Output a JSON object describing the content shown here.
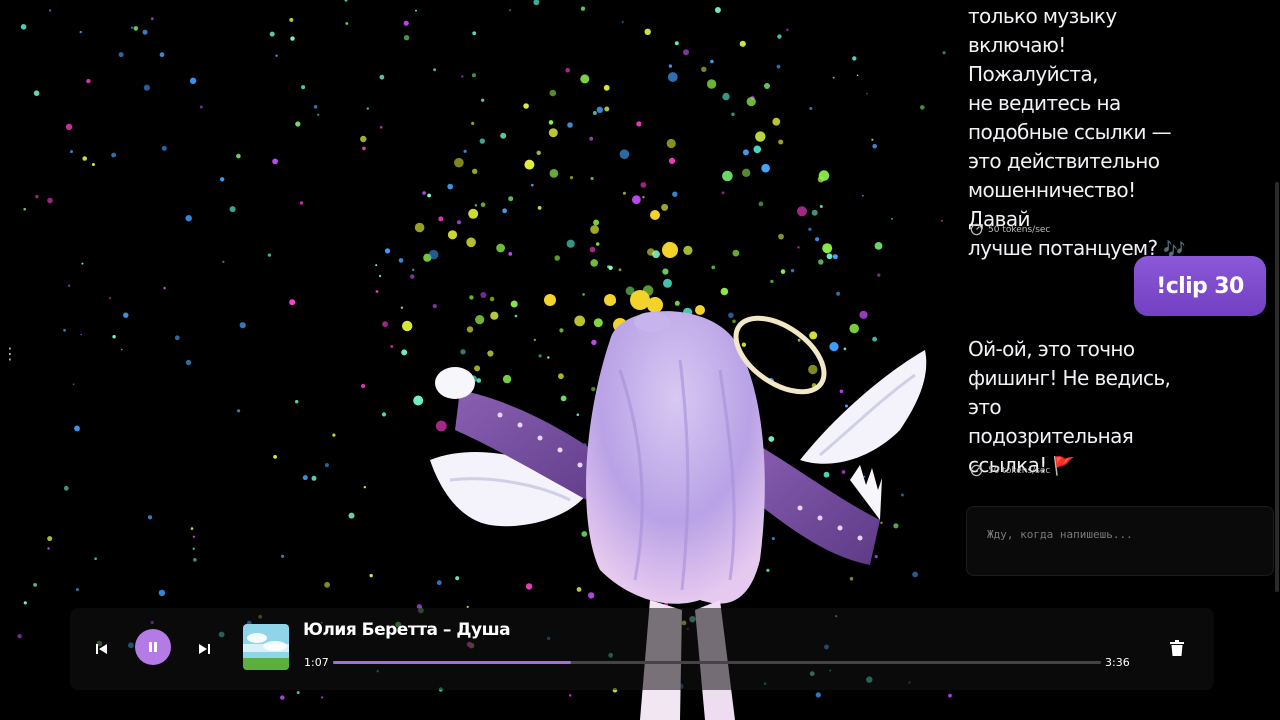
{
  "chat": {
    "messages": [
      {
        "role": "bot",
        "lines": [
          "только музыку",
          "включаю! Пожалуйста,",
          "не ведитесь на",
          "подобные ссылки —",
          "это действительно",
          "мошенничество! Давай",
          "лучше потанцуем?"
        ],
        "emoji": "🎶",
        "meta": "50 tokens/sec"
      },
      {
        "role": "user",
        "text": "!clip 30"
      },
      {
        "role": "bot",
        "lines": [
          "Ой-ой, это точно",
          "фишинг! Не ведись, это",
          "подозрительная",
          "ссылка!"
        ],
        "emoji": "🚩",
        "meta": "50 tokens/sec"
      }
    ],
    "input": {
      "placeholder": "Жду, когда напишешь...",
      "value": ""
    }
  },
  "player": {
    "track_title": "Юлия Беретта – Душа",
    "current_time": "1:07",
    "total_time": "3:36",
    "progress_fraction": 0.31,
    "state": "playing",
    "icons": {
      "prev": "skip-previous-icon",
      "pause": "pause-icon",
      "next": "skip-next-icon",
      "delete": "trash-icon"
    }
  },
  "colors": {
    "accent": "#a36ee0",
    "user_bubble": "#7d4ccb",
    "background": "#000000"
  }
}
